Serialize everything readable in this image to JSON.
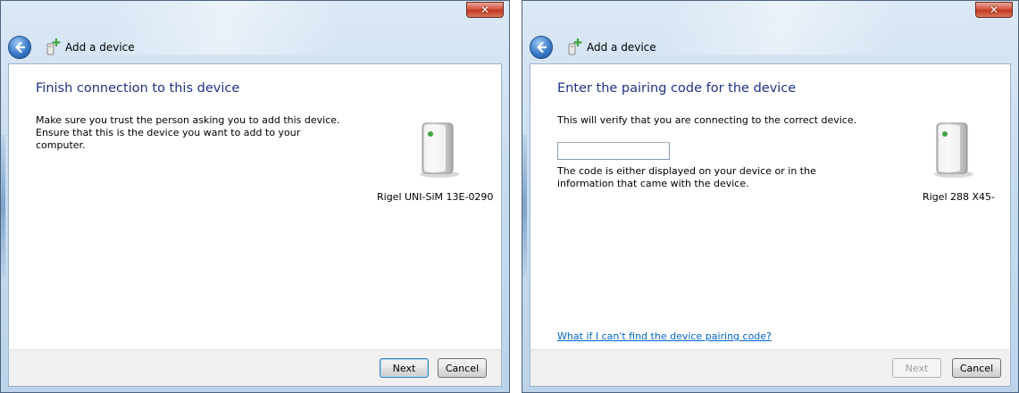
{
  "windows": [
    {
      "title": "Add a device",
      "heading": "Finish connection to this device",
      "body_text": "Make sure you trust the person asking you to add this device. Ensure that this is the device you want to add to your computer.",
      "device_name": "Rigel UNI-SiM 13E-0290",
      "buttons": {
        "next": "Next",
        "cancel": "Cancel"
      }
    },
    {
      "title": "Add a device",
      "heading": "Enter the pairing code for the device",
      "body_text": "This will verify that you are connecting to the correct device.",
      "input_value": "",
      "hint_text": "The code is either displayed on your device or in the information that came with the device.",
      "device_name": "Rigel 288 X45-",
      "help_link": "What if I can't find the device pairing code?",
      "buttons": {
        "next": "Next",
        "cancel": "Cancel"
      }
    }
  ],
  "icons": {
    "back": "back-arrow-icon",
    "wizard": "add-device-icon",
    "close": "close-icon",
    "device": "device-tower-icon"
  },
  "colors": {
    "heading": "#1e3287",
    "link": "#0066cc",
    "close_button": "#c13a22"
  }
}
